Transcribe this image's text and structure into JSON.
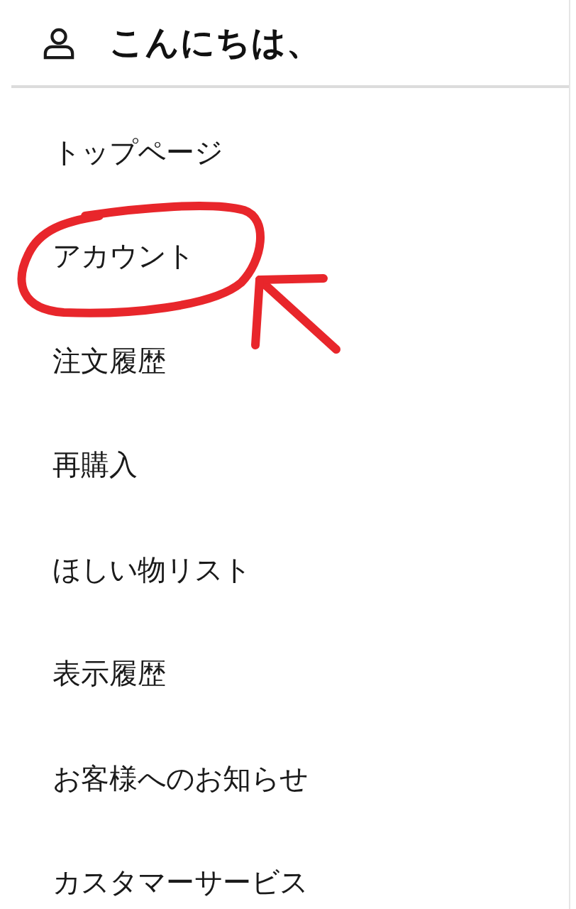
{
  "header": {
    "greeting": "こんにちは、"
  },
  "menu": [
    {
      "label": "トップページ",
      "circled": false
    },
    {
      "label": "アカウント",
      "circled": true
    },
    {
      "label": "注文履歴",
      "circled": false
    },
    {
      "label": "再購入",
      "circled": false
    },
    {
      "label": "ほしい物リスト",
      "circled": false
    },
    {
      "label": "表示履歴",
      "circled": false
    },
    {
      "label": "お客様へのお知らせ",
      "circled": false
    },
    {
      "label": "カスタマーサービス",
      "circled": false
    }
  ]
}
